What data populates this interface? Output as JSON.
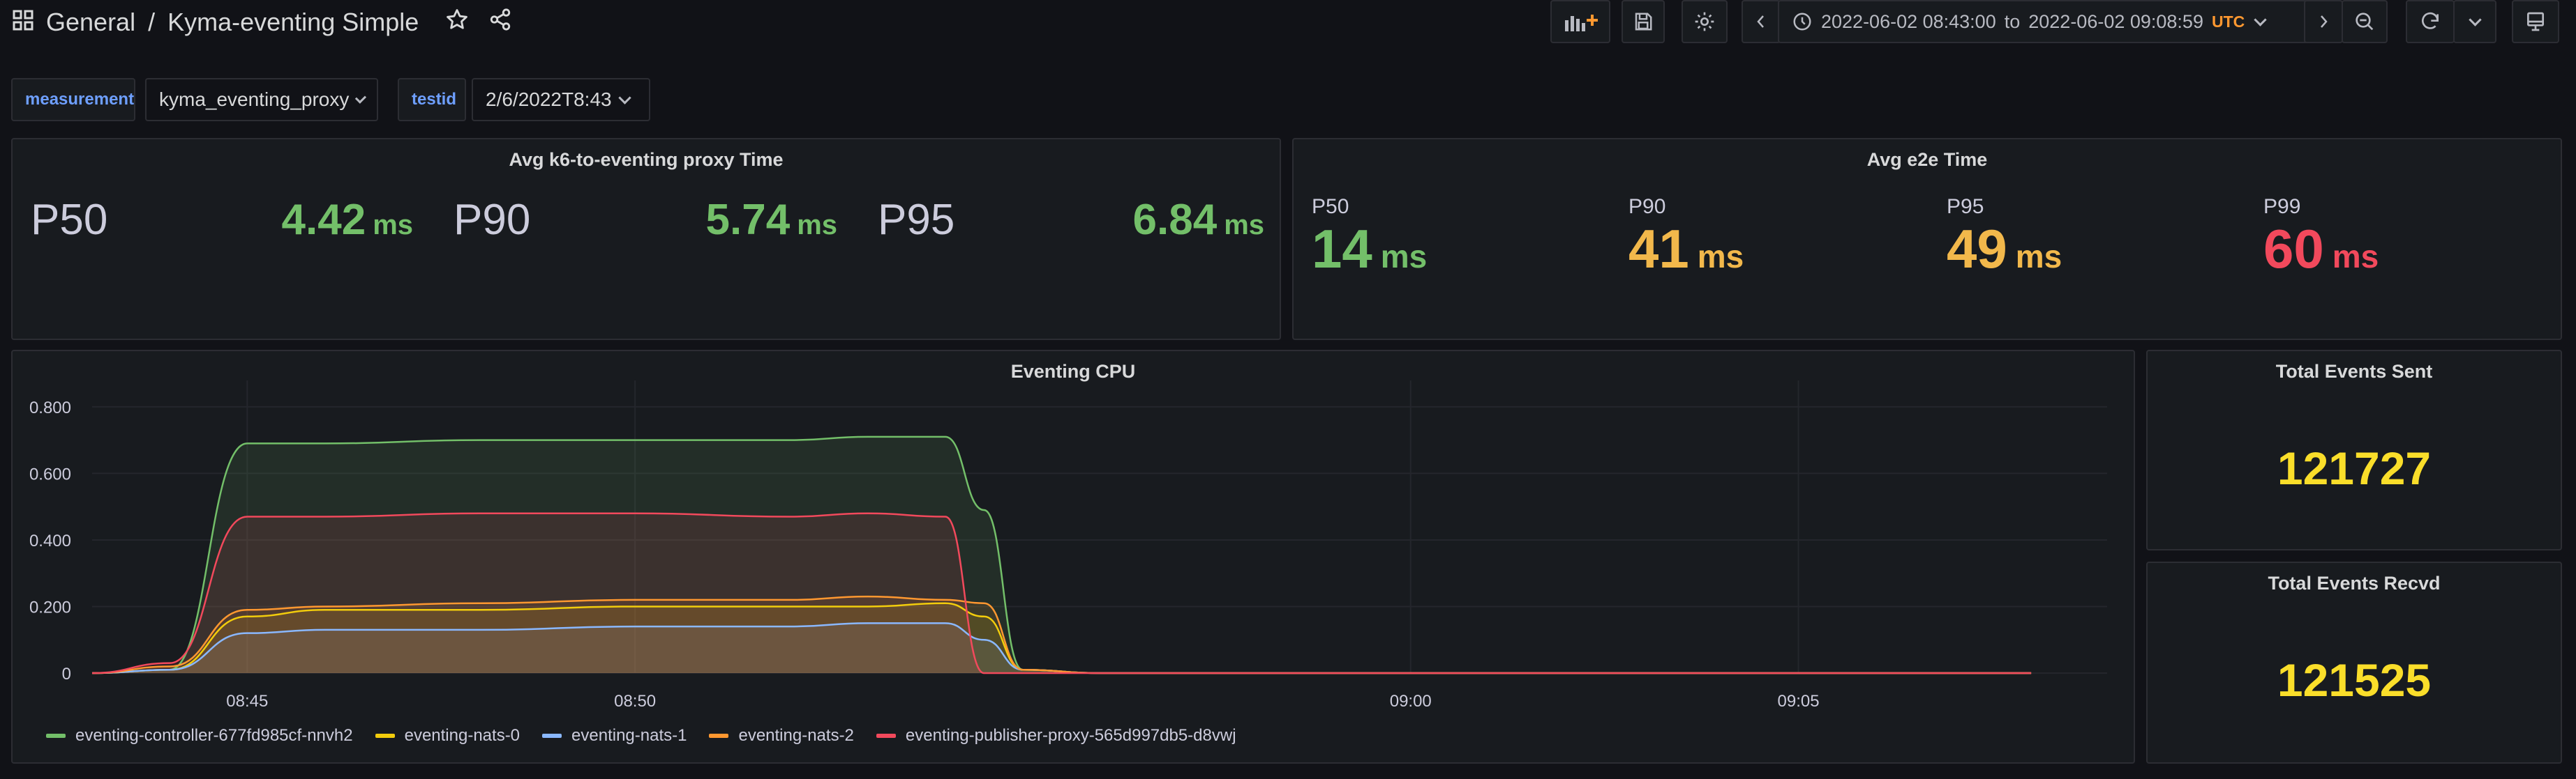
{
  "header": {
    "folder": "General",
    "separator": "/",
    "title": "Kyma-eventing Simple",
    "time_from": "2022-06-02 08:43:00",
    "time_to_word": "to",
    "time_to": "2022-06-02 09:08:59",
    "timezone": "UTC"
  },
  "variables": [
    {
      "label": "measurement",
      "value": "kyma_eventing_proxy"
    },
    {
      "label": "testid",
      "value": "2/6/2022T8:43"
    }
  ],
  "panels": {
    "proxy": {
      "title": "Avg k6-to-eventing proxy Time",
      "stats": [
        {
          "name": "P50",
          "value": "4.42",
          "unit": "ms"
        },
        {
          "name": "P90",
          "value": "5.74",
          "unit": "ms"
        },
        {
          "name": "P95",
          "value": "6.84",
          "unit": "ms"
        }
      ]
    },
    "e2e": {
      "title": "Avg e2e Time",
      "stats": [
        {
          "name": "P50",
          "value": "14",
          "unit": "ms",
          "color": "#73bf69"
        },
        {
          "name": "P90",
          "value": "41",
          "unit": "ms",
          "color": "#f2b84b"
        },
        {
          "name": "P95",
          "value": "49",
          "unit": "ms",
          "color": "#f2b84b"
        },
        {
          "name": "P99",
          "value": "60",
          "unit": "ms",
          "color": "#f2495c"
        }
      ]
    },
    "cpu": {
      "title": "Eventing CPU"
    },
    "sent": {
      "title": "Total Events Sent",
      "value": "121727"
    },
    "recvd": {
      "title": "Total Events Recvd",
      "value": "121525"
    }
  },
  "chart_data": {
    "type": "area",
    "title": "Eventing CPU",
    "x": [
      "08:43",
      "08:44",
      "08:45",
      "08:46",
      "08:48",
      "08:50",
      "08:52",
      "08:53",
      "08:54",
      "08:54:30",
      "08:55",
      "08:56",
      "09:00",
      "09:05",
      "09:08"
    ],
    "x_ticks": [
      "08:45",
      "08:50",
      "09:00",
      "09:05"
    ],
    "y_ticks": [
      "0",
      "0.200",
      "0.400",
      "0.600",
      "0.800"
    ],
    "ylim": [
      0,
      0.85
    ],
    "series": [
      {
        "name": "eventing-controller-677fd985cf-nnvh2",
        "color": "#73bf69",
        "values": [
          0,
          0.01,
          0.69,
          0.69,
          0.7,
          0.7,
          0.7,
          0.71,
          0.71,
          0.49,
          0.01,
          0,
          0,
          0,
          0
        ]
      },
      {
        "name": "eventing-nats-0",
        "color": "#f2cc0c",
        "values": [
          0,
          0.01,
          0.17,
          0.19,
          0.19,
          0.2,
          0.2,
          0.2,
          0.21,
          0.17,
          0.01,
          0,
          0,
          0,
          0
        ]
      },
      {
        "name": "eventing-nats-1",
        "color": "#8ab8ff",
        "values": [
          0,
          0.01,
          0.12,
          0.13,
          0.13,
          0.14,
          0.14,
          0.15,
          0.15,
          0.1,
          0.01,
          0,
          0,
          0,
          0
        ]
      },
      {
        "name": "eventing-nats-2",
        "color": "#ff9830",
        "values": [
          0,
          0.02,
          0.19,
          0.2,
          0.21,
          0.22,
          0.22,
          0.23,
          0.22,
          0.21,
          0.01,
          0,
          0,
          0,
          0
        ]
      },
      {
        "name": "eventing-publisher-proxy-565d997db5-d8vwj",
        "color": "#f2495c",
        "values": [
          0,
          0.03,
          0.47,
          0.47,
          0.48,
          0.48,
          0.47,
          0.48,
          0.47,
          0,
          0,
          0,
          0,
          0,
          0
        ]
      }
    ]
  }
}
